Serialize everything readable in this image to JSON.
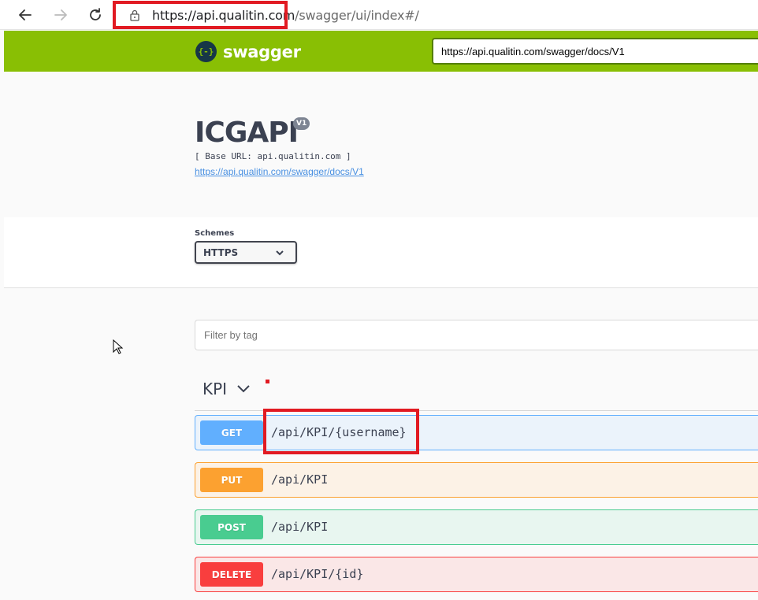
{
  "browser": {
    "url_host": "https://api.qualitin.com",
    "url_path": "/swagger/ui/index#/"
  },
  "topbar": {
    "logo_glyph": "{-}",
    "logo_text": "swagger",
    "spec_url": "https://api.qualitin.com/swagger/docs/V1",
    "color": "#89bf04"
  },
  "info": {
    "title": "ICGAPI",
    "version": "V1",
    "base_url": "[ Base URL: api.qualitin.com ]",
    "spec_link": "https://api.qualitin.com/swagger/docs/V1"
  },
  "schemes": {
    "label": "Schemes",
    "selected": "HTTPS"
  },
  "filter": {
    "placeholder": "Filter by tag"
  },
  "tag": {
    "name": "KPI"
  },
  "operations": [
    {
      "method": "GET",
      "path": "/api/KPI/{username}",
      "color": "#61affe"
    },
    {
      "method": "PUT",
      "path": "/api/KPI",
      "color": "#fca130"
    },
    {
      "method": "POST",
      "path": "/api/KPI",
      "color": "#49cc90"
    },
    {
      "method": "DELETE",
      "path": "/api/KPI/{id}",
      "color": "#f93e3e"
    }
  ],
  "annotations": {
    "highlight_color": "#e11a22"
  }
}
